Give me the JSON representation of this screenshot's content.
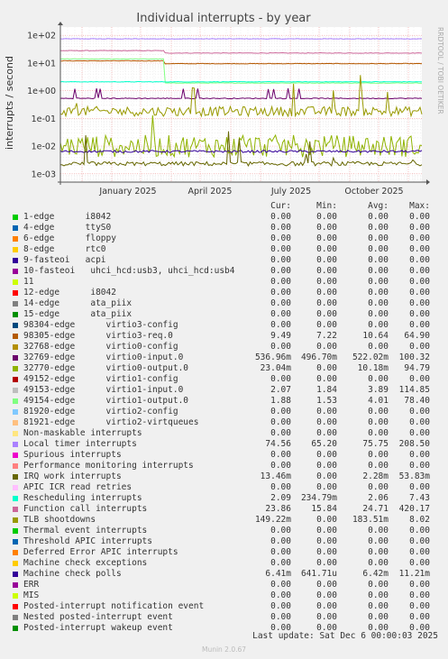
{
  "chart_data": {
    "type": "line",
    "title": "Individual interrupts - by year",
    "ylabel": "interrupts / second",
    "yscale": "log",
    "ylim": [
      0.0005,
      200
    ],
    "y_ticks": [
      "1e-03",
      "1e-02",
      "1e-01",
      "1e+00",
      "1e+01",
      "1e+02"
    ],
    "x_ticks": [
      "January 2025",
      "April 2025",
      "July 2025",
      "October 2025"
    ],
    "side_label": "RRDTOOL / TOBI OETIKER",
    "columns": [
      "Cur:",
      "Min:",
      "Avg:",
      "Max:"
    ],
    "series": [
      {
        "name": "1-edge      i8042",
        "color": "#00cc00",
        "cur": "0.00",
        "min": "0.00",
        "avg": "0.00",
        "max": "0.00"
      },
      {
        "name": "4-edge      ttyS0",
        "color": "#0066b3",
        "cur": "0.00",
        "min": "0.00",
        "avg": "0.00",
        "max": "0.00"
      },
      {
        "name": "6-edge      floppy",
        "color": "#ff8000",
        "cur": "0.00",
        "min": "0.00",
        "avg": "0.00",
        "max": "0.00"
      },
      {
        "name": "8-edge      rtc0",
        "color": "#ffcc00",
        "cur": "0.00",
        "min": "0.00",
        "avg": "0.00",
        "max": "0.00"
      },
      {
        "name": "9-fasteoi   acpi",
        "color": "#330099",
        "cur": "0.00",
        "min": "0.00",
        "avg": "0.00",
        "max": "0.00"
      },
      {
        "name": "10-fasteoi   uhci_hcd:usb3, uhci_hcd:usb4",
        "color": "#990099",
        "cur": "0.00",
        "min": "0.00",
        "avg": "0.00",
        "max": "0.00"
      },
      {
        "name": "11",
        "color": "#ccff00",
        "cur": "0.00",
        "min": "0.00",
        "avg": "0.00",
        "max": "0.00"
      },
      {
        "name": "12-edge      i8042",
        "color": "#ff0000",
        "cur": "0.00",
        "min": "0.00",
        "avg": "0.00",
        "max": "0.00"
      },
      {
        "name": "14-edge      ata_piix",
        "color": "#808080",
        "cur": "0.00",
        "min": "0.00",
        "avg": "0.00",
        "max": "0.00"
      },
      {
        "name": "15-edge      ata_piix",
        "color": "#008f00",
        "cur": "0.00",
        "min": "0.00",
        "avg": "0.00",
        "max": "0.00"
      },
      {
        "name": "98304-edge      virtio3-config",
        "color": "#00487d",
        "cur": "0.00",
        "min": "0.00",
        "avg": "0.00",
        "max": "0.00"
      },
      {
        "name": "98305-edge      virtio3-req.0",
        "color": "#b35a00",
        "cur": "9.49",
        "min": "7.22",
        "avg": "10.64",
        "max": "64.90"
      },
      {
        "name": "32768-edge      virtio0-config",
        "color": "#b38f00",
        "cur": "0.00",
        "min": "0.00",
        "avg": "0.00",
        "max": "0.00"
      },
      {
        "name": "32769-edge      virtio0-input.0",
        "color": "#6b006b",
        "cur": "536.96m",
        "min": "496.70m",
        "avg": "522.02m",
        "max": "100.32"
      },
      {
        "name": "32770-edge      virtio0-output.0",
        "color": "#8fb300",
        "cur": "23.04m",
        "min": "0.00",
        "avg": "10.18m",
        "max": "94.79"
      },
      {
        "name": "49152-edge      virtio1-config",
        "color": "#b30000",
        "cur": "0.00",
        "min": "0.00",
        "avg": "0.00",
        "max": "0.00"
      },
      {
        "name": "49153-edge      virtio1-input.0",
        "color": "#bebebe",
        "cur": "2.07",
        "min": "1.84",
        "avg": "3.89",
        "max": "114.85"
      },
      {
        "name": "49154-edge      virtio1-output.0",
        "color": "#80ff80",
        "cur": "1.88",
        "min": "1.53",
        "avg": "4.01",
        "max": "78.40"
      },
      {
        "name": "81920-edge      virtio2-config",
        "color": "#80c9ff",
        "cur": "0.00",
        "min": "0.00",
        "avg": "0.00",
        "max": "0.00"
      },
      {
        "name": "81921-edge      virtio2-virtqueues",
        "color": "#ffc080",
        "cur": "0.00",
        "min": "0.00",
        "avg": "0.00",
        "max": "0.00"
      },
      {
        "name": "Non-maskable interrupts",
        "color": "#ffe680",
        "cur": "0.00",
        "min": "0.00",
        "avg": "0.00",
        "max": "0.00"
      },
      {
        "name": "Local timer interrupts",
        "color": "#aa80ff",
        "cur": "74.56",
        "min": "65.20",
        "avg": "75.75",
        "max": "208.50"
      },
      {
        "name": "Spurious interrupts",
        "color": "#ee00cc",
        "cur": "0.00",
        "min": "0.00",
        "avg": "0.00",
        "max": "0.00"
      },
      {
        "name": "Performance monitoring interrupts",
        "color": "#ff8080",
        "cur": "0.00",
        "min": "0.00",
        "avg": "0.00",
        "max": "0.00"
      },
      {
        "name": "IRQ work interrupts",
        "color": "#666600",
        "cur": "13.46m",
        "min": "0.00",
        "avg": "2.28m",
        "max": "53.83m"
      },
      {
        "name": "APIC ICR read retries",
        "color": "#ffbfff",
        "cur": "0.00",
        "min": "0.00",
        "avg": "0.00",
        "max": "0.00"
      },
      {
        "name": "Rescheduling interrupts",
        "color": "#00ffcc",
        "cur": "2.09",
        "min": "234.79m",
        "avg": "2.06",
        "max": "7.43"
      },
      {
        "name": "Function call interrupts",
        "color": "#cc6699",
        "cur": "23.86",
        "min": "15.84",
        "avg": "24.71",
        "max": "420.17"
      },
      {
        "name": "TLB shootdowns",
        "color": "#999900",
        "cur": "149.22m",
        "min": "0.00",
        "avg": "183.51m",
        "max": "8.02"
      },
      {
        "name": "Thermal event interrupts",
        "color": "#00cc00",
        "cur": "0.00",
        "min": "0.00",
        "avg": "0.00",
        "max": "0.00"
      },
      {
        "name": "Threshold APIC interrupts",
        "color": "#0066b3",
        "cur": "0.00",
        "min": "0.00",
        "avg": "0.00",
        "max": "0.00"
      },
      {
        "name": "Deferred Error APIC interrupts",
        "color": "#ff8000",
        "cur": "0.00",
        "min": "0.00",
        "avg": "0.00",
        "max": "0.00"
      },
      {
        "name": "Machine check exceptions",
        "color": "#ffcc00",
        "cur": "0.00",
        "min": "0.00",
        "avg": "0.00",
        "max": "0.00"
      },
      {
        "name": "Machine check polls",
        "color": "#330099",
        "cur": "6.41m",
        "min": "641.71u",
        "avg": "6.42m",
        "max": "11.21m"
      },
      {
        "name": "ERR",
        "color": "#990099",
        "cur": "0.00",
        "min": "0.00",
        "avg": "0.00",
        "max": "0.00"
      },
      {
        "name": "MIS",
        "color": "#ccff00",
        "cur": "0.00",
        "min": "0.00",
        "avg": "0.00",
        "max": "0.00"
      },
      {
        "name": "Posted-interrupt notification event",
        "color": "#ff0000",
        "cur": "0.00",
        "min": "0.00",
        "avg": "0.00",
        "max": "0.00"
      },
      {
        "name": "Nested posted-interrupt event",
        "color": "#808080",
        "cur": "0.00",
        "min": "0.00",
        "avg": "0.00",
        "max": "0.00"
      },
      {
        "name": "Posted-interrupt wakeup event",
        "color": "#008f00",
        "cur": "0.00",
        "min": "0.00",
        "avg": "0.00",
        "max": "0.00"
      }
    ],
    "plotted": [
      {
        "series": "Local timer interrupts",
        "color": "#aa80ff",
        "level": 75
      },
      {
        "series": "Function call interrupts",
        "color": "#cc6699",
        "level": 28,
        "after": 23
      },
      {
        "series": "98305-edge      virtio3-req.0",
        "color": "#b35a00",
        "level": 12,
        "after": 9.5
      },
      {
        "series": "49154-edge      virtio1-output.0",
        "color": "#80ff80",
        "level": 14,
        "after": 1.9
      },
      {
        "series": "Rescheduling interrupts",
        "color": "#00ffcc",
        "level": 2.1
      },
      {
        "series": "32769-edge      virtio0-input.0",
        "color": "#6b006b",
        "level": 0.53
      },
      {
        "series": "TLB shootdowns",
        "color": "#999900",
        "level": 0.18
      },
      {
        "series": "32770-edge      virtio0-output.0",
        "color": "#8fb300",
        "level": 0.01
      },
      {
        "series": "Machine check polls",
        "color": "#330099",
        "level": 0.0064
      },
      {
        "series": "IRQ work interrupts",
        "color": "#666600",
        "level": 0.0023
      }
    ]
  },
  "footer": {
    "last_update": "Last update: Sat Dec  6 00:00:03 2025",
    "munin": "Munin 2.0.67"
  }
}
